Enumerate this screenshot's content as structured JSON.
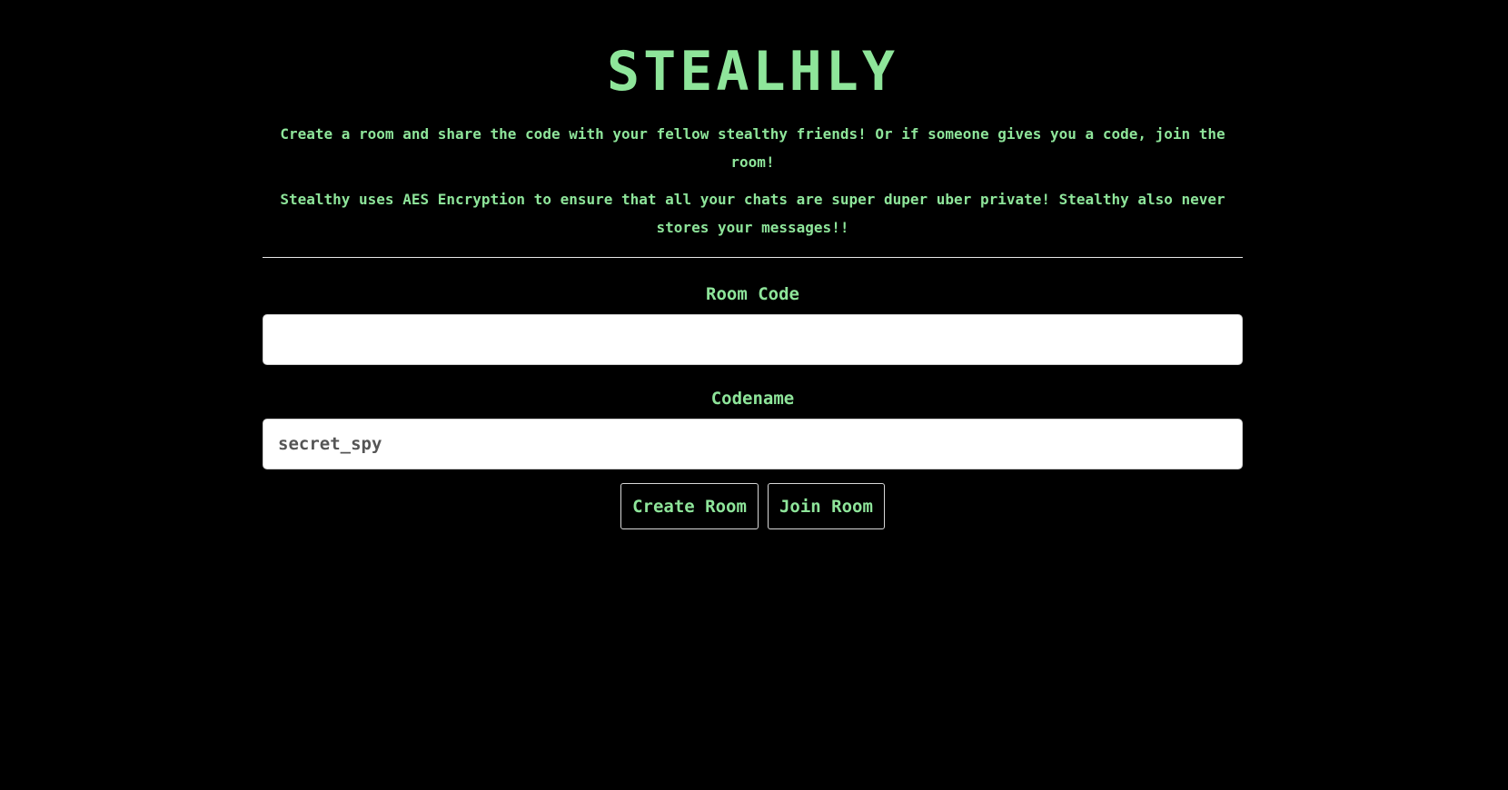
{
  "app": {
    "title": "STEALHLY"
  },
  "description": {
    "intro": "Create a room and share the code with your fellow stealthy friends! Or if someone gives you a code, join the room!",
    "security": "Stealthy uses AES Encryption to ensure that all your chats are super duper uber private! Stealthy also never stores your messages!!"
  },
  "form": {
    "room_code": {
      "label": "Room Code",
      "value": "",
      "placeholder": ""
    },
    "codename": {
      "label": "Codename",
      "value": "",
      "placeholder": "secret_spy"
    }
  },
  "actions": {
    "create_label": "Create Room",
    "join_label": "Join Room"
  },
  "colors": {
    "background": "#000000",
    "accent_green": "#8ee59a",
    "input_background": "#ffffff",
    "border": "#d8d8d8"
  }
}
